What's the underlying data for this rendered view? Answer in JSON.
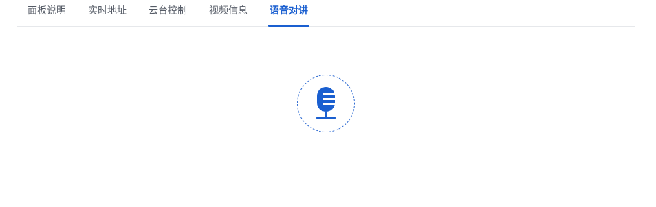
{
  "tabs": [
    {
      "label": "面板说明",
      "active": false
    },
    {
      "label": "实时地址",
      "active": false
    },
    {
      "label": "云台控制",
      "active": false
    },
    {
      "label": "视频信息",
      "active": false
    },
    {
      "label": "语音对讲",
      "active": true
    }
  ],
  "voice_talk": {
    "icon": "microphone-icon"
  },
  "colors": {
    "accent": "#1a5fd0",
    "tab_text": "#555b66",
    "divider": "#e6e8eb"
  }
}
